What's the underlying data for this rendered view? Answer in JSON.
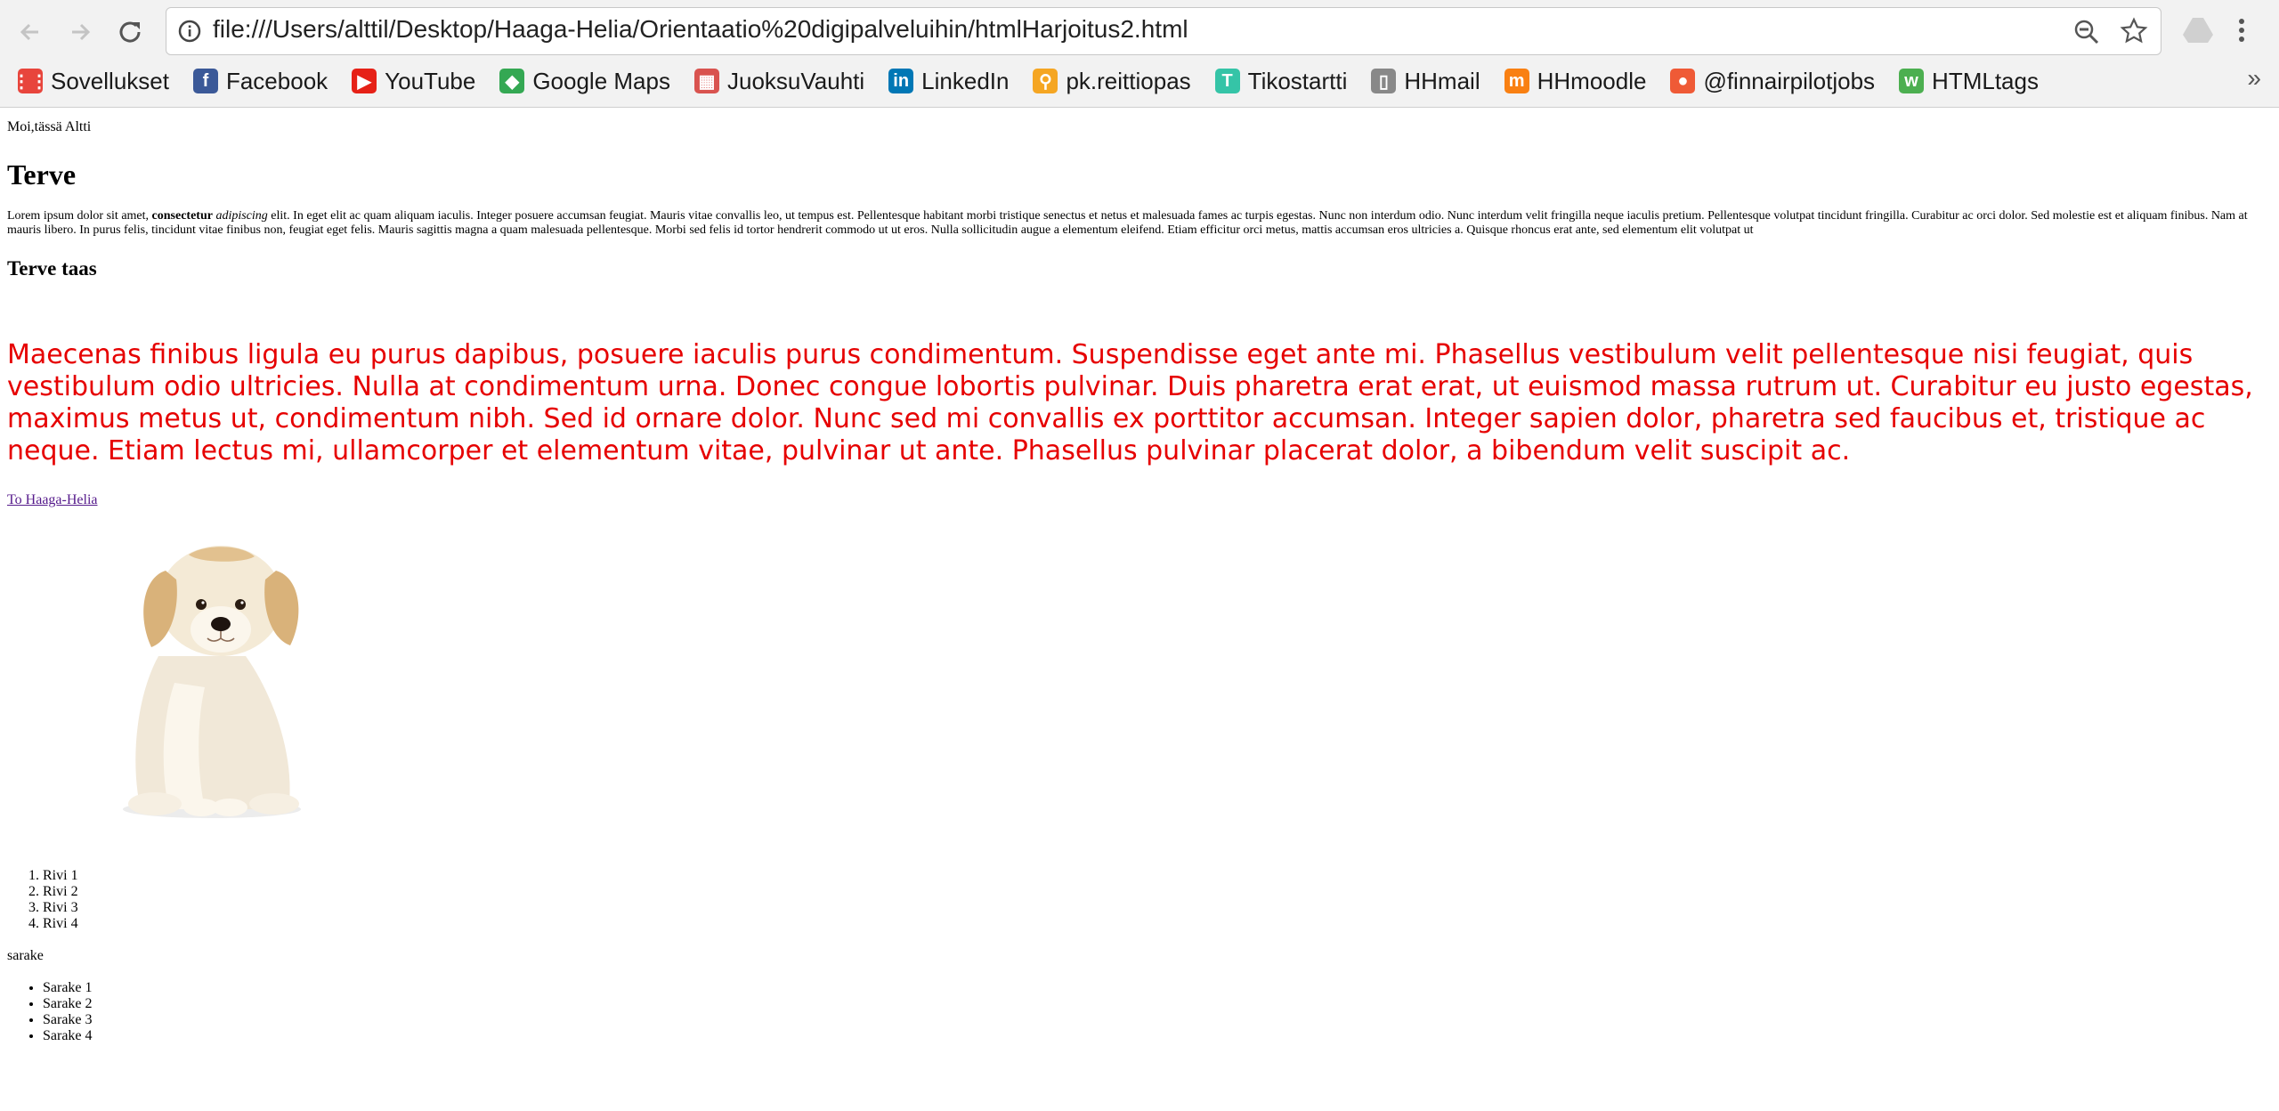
{
  "browser": {
    "url": "file:///Users/alttil/Desktop/Haaga-Helia/Orientaatio%20digipalveluihin/htmlHarjoitus2.html",
    "bookmarks": [
      {
        "label": "Sovellukset",
        "icon": "apps-grid-icon",
        "color": "#e8453c"
      },
      {
        "label": "Facebook",
        "icon": "facebook-icon",
        "color": "#3b5998"
      },
      {
        "label": "YouTube",
        "icon": "youtube-icon",
        "color": "#e62117"
      },
      {
        "label": "Google Maps",
        "icon": "google-maps-icon",
        "color": "#34a853"
      },
      {
        "label": "JuoksuVauhti",
        "icon": "calculator-icon",
        "color": "#d9534f"
      },
      {
        "label": "LinkedIn",
        "icon": "linkedin-icon",
        "color": "#0077b5"
      },
      {
        "label": "pk.reittiopas",
        "icon": "bike-icon",
        "color": "#f5a623"
      },
      {
        "label": "Tikostartti",
        "icon": "tiko-icon",
        "color": "#35c4a7"
      },
      {
        "label": "HHmail",
        "icon": "document-icon",
        "color": "#888888"
      },
      {
        "label": "HHmoodle",
        "icon": "moodle-icon",
        "color": "#f98012"
      },
      {
        "label": "@finnairpilotjobs",
        "icon": "owl-icon",
        "color": "#ef5a36"
      },
      {
        "label": "HTMLtags",
        "icon": "w3schools-icon",
        "color": "#4caf50"
      }
    ],
    "overflow_label": "»"
  },
  "page": {
    "intro": "Moi,tässä Altti",
    "heading1": "Terve",
    "lorem": {
      "before": "Lorem ipsum dolor sit amet, ",
      "bold": "consectetur",
      "italic": "adipiscing",
      "after": " elit. In eget elit ac quam aliquam iaculis. Integer posuere accumsan feugiat. Mauris vitae convallis leo, ut tempus est. Pellentesque habitant morbi tristique senectus et netus et malesuada fames ac turpis egestas. Nunc non interdum odio. Nunc interdum velit fringilla neque iaculis pretium. Pellentesque volutpat tincidunt fringilla. Curabitur ac orci dolor. Sed molestie est et aliquam finibus. Nam at mauris libero. In purus felis, tincidunt vitae finibus non, feugiat eget felis. Mauris sagittis magna a quam malesuada pellentesque. Morbi sed felis id tortor hendrerit commodo ut ut eros. Nulla sollicitudin augue a elementum eleifend. Etiam efficitur orci metus, mattis accumsan eros ultricies a. Quisque rhoncus erat ante, sed elementum elit volutpat ut"
    },
    "heading3": "Terve taas",
    "red_paragraph": "Maecenas finibus ligula eu purus dapibus, posuere iaculis purus condimentum. Suspendisse eget ante mi. Phasellus vestibulum velit pellentesque nisi feugiat, quis vestibulum odio ultricies. Nulla at condimentum urna. Donec congue lobortis pulvinar. Duis pharetra erat erat, ut euismod massa rutrum ut. Curabitur eu justo egestas, maximus metus ut, condimentum nibh. Sed id ornare dolor. Nunc sed mi convallis ex porttitor accumsan. Integer sapien dolor, pharetra sed faucibus et, tristique ac neque. Etiam lectus mi, ullamcorper et elementum vitae, pulvinar ut ante. Phasellus pulvinar placerat dolor, a bibendum velit suscipit ac.",
    "red_color": "#e60000",
    "link_text": "To Haaga-Helia",
    "image_subject": "puppy-image",
    "ordered_list": [
      "Rivi 1",
      "Rivi 2",
      "Rivi 3",
      "Rivi 4"
    ],
    "list_label": "sarake",
    "unordered_list": [
      "Sarake 1",
      "Sarake 2",
      "Sarake 3",
      "Sarake 4"
    ]
  }
}
